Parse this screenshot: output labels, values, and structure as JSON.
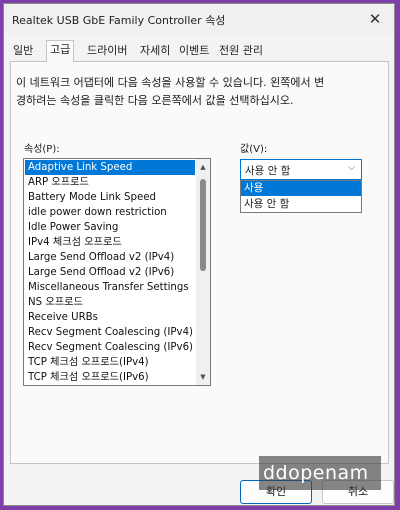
{
  "window": {
    "title": "Realtek USB GbE Family Controller 속성",
    "close_glyph": "✕"
  },
  "tabs": [
    {
      "label": "일반",
      "active": false
    },
    {
      "label": "고급",
      "active": true
    },
    {
      "label": "드라이버",
      "active": false
    },
    {
      "label": "자세히",
      "active": false
    },
    {
      "label": "이벤트",
      "active": false
    },
    {
      "label": "전원 관리",
      "active": false
    }
  ],
  "description": {
    "line1": "이 네트워크 어댑터에 다음 속성을 사용할 수 있습니다. 왼쪽에서 변",
    "line2": "경하려는 속성을 클릭한 다음 오른쪽에서 값을 선택하십시오."
  },
  "property_label": "속성(P):",
  "value_label": "값(V):",
  "properties": [
    {
      "label": "Adaptive Link Speed",
      "selected": true
    },
    {
      "label": "ARP 오프로드"
    },
    {
      "label": "Battery Mode Link Speed"
    },
    {
      "label": "idle power down restriction"
    },
    {
      "label": "Idle Power Saving"
    },
    {
      "label": "IPv4 체크섬 오프로드"
    },
    {
      "label": "Large Send Offload v2 (IPv4)"
    },
    {
      "label": "Large Send Offload v2 (IPv6)"
    },
    {
      "label": "Miscellaneous Transfer Settings"
    },
    {
      "label": "NS 오프로드"
    },
    {
      "label": "Receive URBs"
    },
    {
      "label": "Recv Segment Coalescing (IPv4)"
    },
    {
      "label": "Recv Segment Coalescing (IPv6)"
    },
    {
      "label": "TCP 체크섬 오프로드(IPv4)"
    },
    {
      "label": "TCP 체크섬 오프로드(IPv6)"
    }
  ],
  "value_combo": {
    "current": "사용 안 함",
    "arrow_icon": "chevron-down-icon"
  },
  "value_options": [
    {
      "label": "사용",
      "selected": true
    },
    {
      "label": "사용 안 함",
      "selected": false
    }
  ],
  "buttons": {
    "ok": "확인",
    "cancel": "취소"
  },
  "watermark": "ddopenam"
}
